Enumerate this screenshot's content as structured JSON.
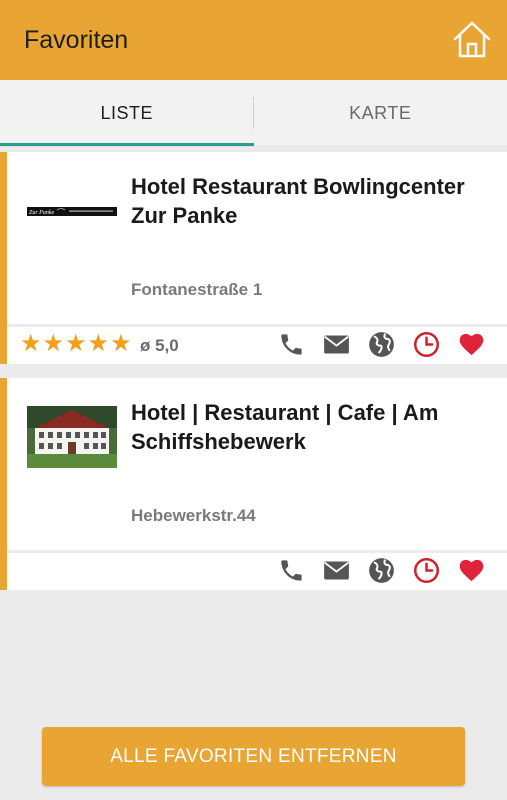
{
  "header": {
    "title": "Favoriten",
    "home_icon": "home-icon"
  },
  "tabs": [
    {
      "label": "LISTE",
      "active": true
    },
    {
      "label": "KARTE",
      "active": false
    }
  ],
  "favorites": [
    {
      "name": "Hotel Restaurant Bowlingcenter Zur Panke",
      "address": "Fontanestraße 1",
      "rating_stars": 5,
      "rating_text": "ø 5,0",
      "thumbnail": "logo-image"
    },
    {
      "name": "Hotel | Restaurant | Cafe | Am Schiffshebewerk",
      "address": "Hebewerkstr.44",
      "thumbnail": "hotel-photo"
    }
  ],
  "actions": [
    "phone-icon",
    "mail-icon",
    "globe-icon",
    "clock-icon",
    "heart-icon"
  ],
  "remove_button": {
    "label": "ALLE FAVORITEN ENTFERNEN"
  },
  "colors": {
    "accent": "#e8a534",
    "tab_indicator": "#2a9d8f",
    "heart": "#e0223b",
    "clock": "#d0202a",
    "star": "#f2a01c"
  }
}
